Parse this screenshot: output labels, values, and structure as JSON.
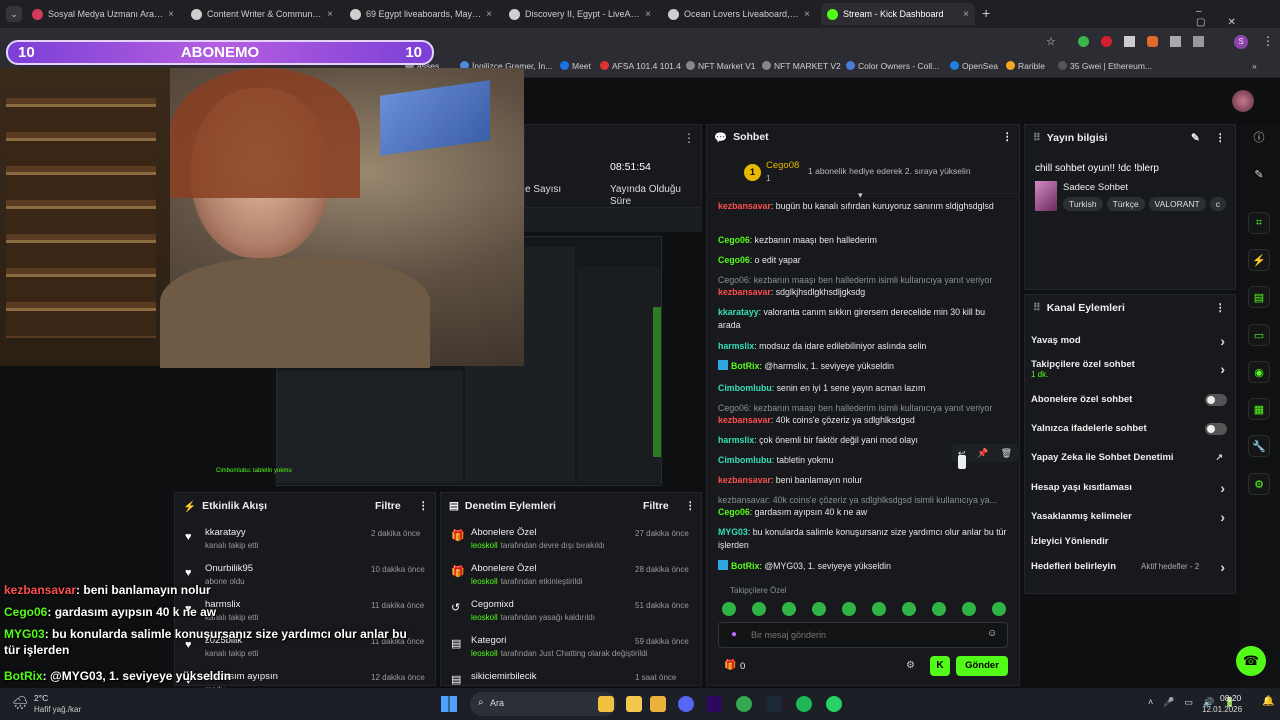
{
  "browser": {
    "tabs": [
      {
        "label": "Sosyal Medya Uzmanı Aranıyor",
        "color": "#d33a5c"
      },
      {
        "label": "Content Writer & Community M",
        "color": "#cfcfcf"
      },
      {
        "label": "69 Egypt liveaboards, May 2026",
        "color": "#cfcfcf"
      },
      {
        "label": "Discovery II, Egypt - LiveAboard",
        "color": "#cfcfcf"
      },
      {
        "label": "Ocean Lovers Liveaboard, Egypt",
        "color": "#cfcfcf"
      },
      {
        "label": "Stream - Kick Dashboard",
        "color": "#53fc18"
      }
    ],
    "new_tab": "+",
    "close": "×",
    "bookmarks": [
      "asses",
      "İngilizce Gramer, İn...",
      "Meet",
      "AFSA 101.4 101.4",
      "NFT Market V1",
      "NFT MARKET V2",
      "Color Owners - Coll...",
      "OpenSea",
      "Rarible",
      "35 Gwei | Ethereum..."
    ]
  },
  "overlay": {
    "banner_left": "10",
    "banner_title": "ABONEMO",
    "banner_right": "10"
  },
  "stats": {
    "viewers_label": "e Sayısı",
    "time_value": "08:51:54",
    "time_label": "Yayında Olduğu Süre"
  },
  "activity": {
    "title": "Etkinlik Akışı",
    "filter": "Filtre",
    "items": [
      {
        "user": "kkaratayy",
        "desc": "kanalı takip etti",
        "time": "2 dakika önce"
      },
      {
        "user": "Onurbilik95",
        "desc": "abone oldu",
        "time": "10 dakika önce"
      },
      {
        "user": "harmslix",
        "desc": "kanalı takip etti",
        "time": "11 dakika önce"
      },
      {
        "user": "z025bilik",
        "desc": "kanalı takip etti",
        "time": "11 dakika önce"
      },
      {
        "user": "gardasım ayıpsın",
        "desc": "modu",
        "time": "12 dakika önce"
      }
    ]
  },
  "moderation": {
    "title": "Denetim Eylemleri",
    "filter": "Filtre",
    "items": [
      {
        "title": "Abonelere Özel",
        "user": "leoskoll",
        "desc": "tarafından devre dışı bırakıldı",
        "time": "27 dakika önce"
      },
      {
        "title": "Abonelere Özel",
        "user": "leoskoll",
        "desc": "tarafından etkinleştirildi",
        "time": "28 dakika önce"
      },
      {
        "title": "Cegomixd",
        "user": "leoskoll",
        "desc": "tarafından yasağı kaldırıldı",
        "time": "51 dakika önce"
      },
      {
        "title": "Kategori",
        "user": "leoskoll",
        "desc": "tarafından Just Chatting olarak değiştirildi",
        "time": "59 dakika önce"
      },
      {
        "title": "sikiciemirbilecik",
        "user": "",
        "desc": "",
        "time": "1 saat önce"
      }
    ]
  },
  "chat": {
    "title": "Sohbet",
    "pinned_user": "Cego08",
    "pinned_count": "1",
    "pinned_msg": "1 abonelik hediye ederek 2. sıraya yükselin",
    "messages": [
      {
        "user": "kezbansavar",
        "cls": "red",
        "text": ": bugün bu kanalı sıfırdan kuruyoruz sanırım sldjghsdglsd"
      },
      {
        "user": "Cego06",
        "cls": "green",
        "text": ": kezbanın maaşı ben hallederim"
      },
      {
        "user": "Cego06",
        "cls": "green",
        "text": ": o edit yapar"
      },
      {
        "user": "",
        "cls": "grey",
        "text": "Cego06: kezbanın maaşı ben hallederim isimli kullanıcıya yanıt veriyor"
      },
      {
        "user": "kezbansavar",
        "cls": "red",
        "text": ": sdglkjhsdlgkhsdljgksdg"
      },
      {
        "user": "kkaratayy",
        "cls": "teal",
        "text": ": valoranta canım sıkkın girersem derecelide min 30 kill bu arada"
      },
      {
        "user": "harmslix",
        "cls": "teal",
        "text": ": modsuz da idare edilebiliniyor aslında selin"
      },
      {
        "user": "BotRix",
        "cls": "green",
        "text": ": @harmslix, 1. seviyeye yükseldin"
      },
      {
        "user": "Cimbomlubu",
        "cls": "teal",
        "text": ": senin en iyi 1 sene yayın acman lazım"
      },
      {
        "user": "",
        "cls": "grey",
        "text": "Cego06: kezbanın maaşı ben hallederim isimli kullanıcıya yanıt veriyor"
      },
      {
        "user": "kezbansavar",
        "cls": "red",
        "text": ": 40k coins'e çözeriz ya sdlghlksdgsd"
      },
      {
        "user": "harmslix",
        "cls": "teal",
        "text": ": çok önemli bir faktör değil yani mod olayı"
      },
      {
        "user": "Cimbomlubu",
        "cls": "teal",
        "text": ": tabletin yokmu"
      },
      {
        "user": "kezbansavar",
        "cls": "red",
        "text": ": beni banlamayın nolur"
      },
      {
        "user": "",
        "cls": "grey",
        "text": "kezbansavar: 40k coins'e çözeriz ya sdlghlksdgsd isimli kullanıcıya ya..."
      },
      {
        "user": "Cego06",
        "cls": "green",
        "text": ": gardasım ayıpsın 40 k ne aw"
      },
      {
        "user": "MYG03",
        "cls": "teal",
        "text": ": bu konularda salimle konuşursanız size yardımcı olur anlar bu tür işlerden"
      },
      {
        "user": "BotRix",
        "cls": "green",
        "text": ": @MYG03, 1. seviyeye yükseldin"
      }
    ],
    "followers_only": "Takipçilere Özel",
    "input_placeholder": "Bir mesaj gönderin",
    "count": "0",
    "send": "Gönder"
  },
  "stream_info": {
    "title": "Yayın bilgisi",
    "stream_title": "chill sohbet oyun!! !dc !blerp",
    "category": "Sadece Sohbet",
    "tags": [
      "Turkish",
      "Türkçe",
      "VALORANT",
      "c"
    ]
  },
  "channel_actions": {
    "title": "Kanal Eylemleri",
    "items": [
      {
        "label": "Yavaş mod",
        "sub": "",
        "control": "chevron"
      },
      {
        "label": "Takipçilere özel sohbet",
        "sub": "1 dk.",
        "control": "chevron"
      },
      {
        "label": "Abonelere özel sohbet",
        "sub": "",
        "control": "toggle"
      },
      {
        "label": "Yalnızca ifadelerle sohbet",
        "sub": "",
        "control": "toggle"
      },
      {
        "label": "Yapay Zeka ile Sohbet Denetimi",
        "sub": "",
        "control": "external"
      },
      {
        "label": "Hesap yaşı kısıtlaması",
        "sub": "",
        "control": "chevron"
      },
      {
        "label": "Yasaklanmış kelimeler",
        "sub": "",
        "control": "chevron"
      },
      {
        "label": "İzleyici Yönlendir",
        "sub": "",
        "control": ""
      },
      {
        "label": "Hedefleri belirleyin",
        "sub": "",
        "control": "chevron"
      }
    ],
    "goals_active": "Aktif hedefler - 2"
  },
  "overlay_chat": [
    {
      "user": "kezbansavar",
      "color": "#ff4e4e",
      "text": ": beni banlamayın nolur"
    },
    {
      "user": "Cego06",
      "color": "#53fc18",
      "text": ": gardasım ayıpsın 40 k ne aw"
    },
    {
      "user": "MYG03",
      "color": "#53fc18",
      "text": ": bu konularda salimle konuşursanız size yardımcı olur anlar bu tür işlerden"
    },
    {
      "user": "BotRix",
      "color": "#53fc18",
      "text": ": @MYG03, 1. seviyeye yükseldin"
    }
  ],
  "taskbar": {
    "weather_temp": "2°C",
    "weather_desc": "Hafif yağ./kar",
    "search": "Ara",
    "time": "08:20",
    "date": "12.01.2026"
  }
}
